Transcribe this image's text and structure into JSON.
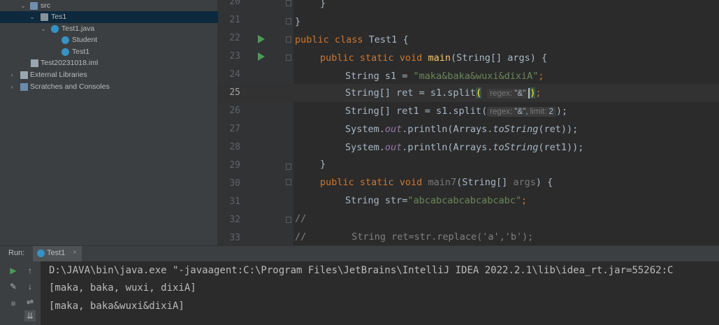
{
  "project_tree": {
    "src": "src",
    "pkg": "Tes1",
    "file": "Test1.java",
    "class_student": "Student",
    "class_test1": "Test1",
    "iml": "Test20231018.iml",
    "ext_libs": "External Libraries",
    "scratches": "Scratches and Consoles"
  },
  "editor": {
    "line_numbers": [
      "20",
      "21",
      "22",
      "23",
      "24",
      "25",
      "26",
      "27",
      "28",
      "29",
      "30",
      "31",
      "32",
      "33"
    ],
    "current_line": "25",
    "l20": "}",
    "l21": "}",
    "l22_a": "public class ",
    "l22_b": "Test1 {",
    "l23_a": "public static void ",
    "l23_b": "main",
    "l23_c": "(String[] args) {",
    "l24_a": "String s1 = ",
    "l24_b": "\"maka&baka&wuxi&dixiA\"",
    "l24_c": ";",
    "l25_a": "String[] ret = s1.split",
    "l25_open": "(",
    "l25_hint": "regex:",
    "l25_val": "\"&\"",
    "l25_close": ")",
    "l25_end": ";",
    "l26_a": "String[] ret1 = s1.split(",
    "l26_hint1": "regex:",
    "l26_val1": "\"&\",",
    "l26_hint2": "limit:",
    "l26_val2": "2",
    "l26_end": ");",
    "l27_a": "System.",
    "l27_out": "out",
    "l27_b": ".println(Arrays.",
    "l27_ts": "toString",
    "l27_c": "(ret));",
    "l28_a": "System.",
    "l28_out": "out",
    "l28_b": ".println(Arrays.",
    "l28_ts": "toString",
    "l28_c": "(ret1));",
    "l29": "}",
    "l30_a": "public static void ",
    "l30_b": "main7",
    "l30_c": "(String[] ",
    "l30_d": "args",
    "l30_e": ") {",
    "l31_a": "String str=",
    "l31_b": "\"abcabcabcabcabcabc\"",
    "l31_c": ";",
    "l32": "//",
    "l33": "//        String ret=str.replace('a','b');"
  },
  "run_panel": {
    "label": "Run:",
    "tab_title": "Test1",
    "tab_close": "×",
    "output": [
      "D:\\JAVA\\bin\\java.exe \"-javaagent:C:\\Program Files\\JetBrains\\IntelliJ IDEA 2022.2.1\\lib\\idea_rt.jar=55262:C",
      "[maka, baka, wuxi, dixiA]",
      "[maka, baka&wuxi&dixiA]"
    ]
  }
}
